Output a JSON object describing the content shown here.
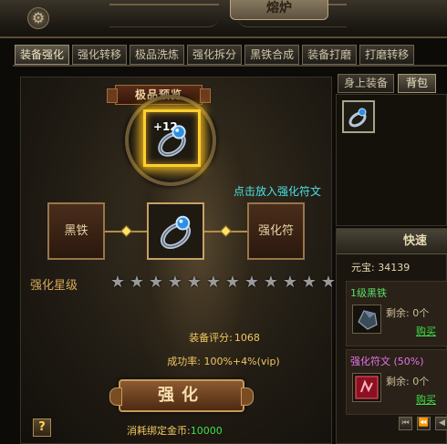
{
  "window": {
    "title": "熔炉"
  },
  "tabs": [
    {
      "label": "装备强化"
    },
    {
      "label": "强化转移"
    },
    {
      "label": "极品洗炼"
    },
    {
      "label": "强化拆分"
    },
    {
      "label": "黑铁合成"
    },
    {
      "label": "装备打磨"
    },
    {
      "label": "打磨转移"
    }
  ],
  "active_tab": "装备强化",
  "forge": {
    "banner": "极品预览",
    "preview_level": "+12",
    "hint": "点击放入强化符文",
    "slot_left": "黑铁",
    "slot_right": "强化符",
    "star_label": "强化星级",
    "stars_total": 12,
    "stars_lit": 0,
    "score_label": "装备评分:",
    "score_value": "1068",
    "rate_text": "成功率: 100%+4%(vip)",
    "button": "强化",
    "cost_label": "消耗绑定金币:",
    "cost_value": "10000",
    "help": "?"
  },
  "right": {
    "tabs": [
      {
        "label": "身上装备"
      },
      {
        "label": "背包"
      }
    ],
    "active_tab": "背包"
  },
  "quick": {
    "title": "快速",
    "yuanbao_label": "元宝:",
    "yuanbao_value": "34139",
    "items": [
      {
        "name": "1级黑铁",
        "remain": "剩余: 0个",
        "buy": "购买"
      },
      {
        "name": "强化符文 (50%)",
        "remain": "剩余: 0个",
        "buy": "购买"
      }
    ],
    "pager": [
      "⏮",
      "⏪",
      "◀",
      "▶"
    ]
  },
  "colors": {
    "accent_gold": "#ffcf2e",
    "hint_cyan": "#49e3e3",
    "cost_green": "#3fe04a",
    "purple_item": "#e274ea"
  }
}
